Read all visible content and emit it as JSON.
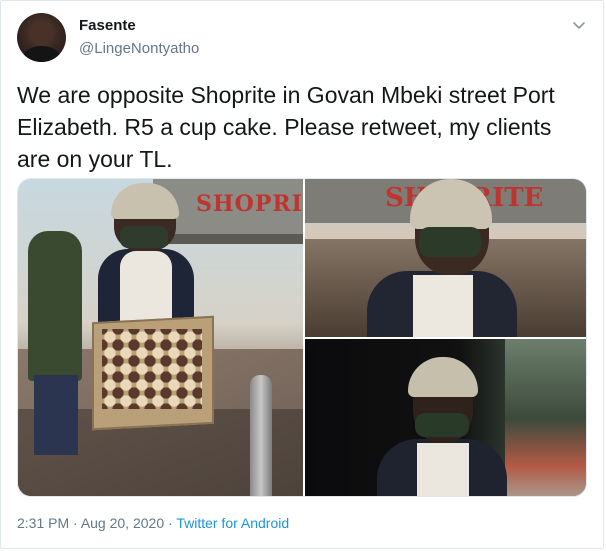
{
  "tweet": {
    "author": {
      "display_name": "Fasente",
      "handle": "@LingeNontyatho"
    },
    "text": "We are opposite Shoprite in Govan Mbeki street Port Elizabeth. R5 a cup cake. Please retweet, my clients are on your TL.",
    "media": {
      "store_sign_left": "SHOPRI",
      "store_sign_right": "SHOPRITE"
    },
    "footer": {
      "time": "2:31 PM",
      "separator1": " · ",
      "date": "Aug 20, 2020",
      "separator2": " · ",
      "source": "Twitter for Android"
    }
  },
  "icons": {
    "menu": "chevron-down-icon"
  },
  "colors": {
    "link": "#1b95e0",
    "secondary_text": "#657786",
    "border": "#e1e8ed"
  }
}
